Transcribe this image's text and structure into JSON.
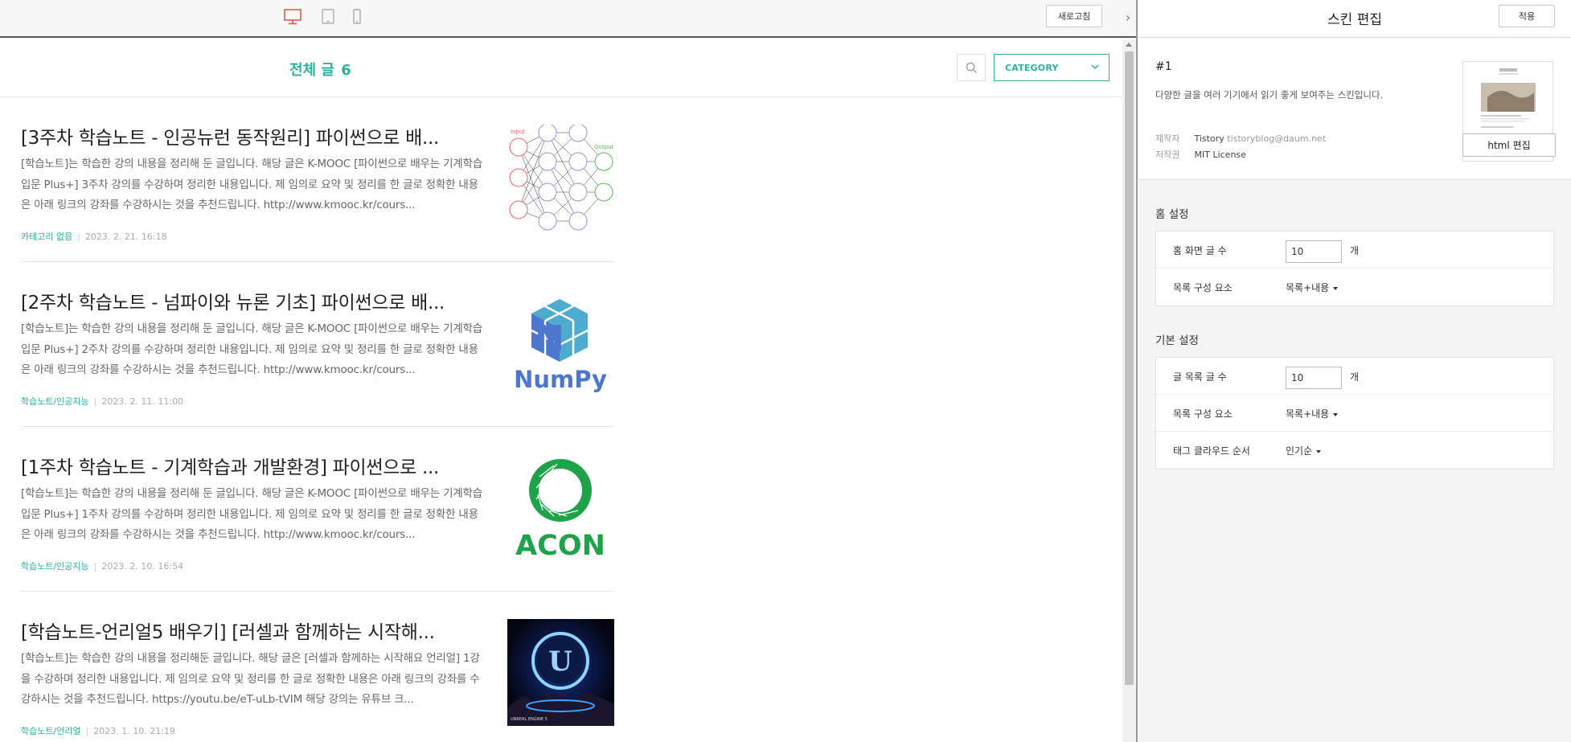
{
  "toolbar": {
    "devices": [
      {
        "name": "desktop",
        "icon": "desktop-monitor-icon",
        "active": true
      },
      {
        "name": "tablet",
        "icon": "tablet-icon",
        "active": false
      },
      {
        "name": "mobile",
        "icon": "mobile-phone-icon",
        "active": false
      }
    ],
    "refresh_label": "새로고침",
    "collapse_icon": "chevron-right-icon"
  },
  "blog": {
    "total_label": "전체 글",
    "total_count": "6",
    "search_icon": "search-icon",
    "category_label": "CATEGORY",
    "accent_color": "#2fae9b",
    "posts": [
      {
        "title": "[3주차 학습노트 - 인공뉴런 동작원리] 파이썬으로 배...",
        "excerpt": "[학습노트]는 학습한 강의 내용을 정리해 둔 글입니다. 해당 글은 K-MOOC [파이썬으로 배우는 기계학습 입문 Plus+] 3주차 강의를 수강하며 정리한 내용입니다. 제 임의로 요약 및 정리를 한 글로 정확한 내용은 아래 링크의 강좌를 수강하시는 것을 추천드립니다. http://www.kmooc.kr/cours...",
        "category": "카테고리 없음",
        "date": "2023. 2. 21. 16:18",
        "thumbnail": "neural-network-diagram",
        "thumb_labels": {
          "input": "Input",
          "output": "Output"
        }
      },
      {
        "title": "[2주차 학습노트 - 넘파이와 뉴론 기초] 파이썬으로 배...",
        "excerpt": "[학습노트]는 학습한 강의 내용을 정리해 둔 글입니다. 해당 글은 K-MOOC [파이썬으로 배우는 기계학습 입문 Plus+] 2주차 강의를 수강하며 정리한 내용입니다. 제 임의로 요약 및 정리를 한 글로 정확한 내용은 아래 링크의 강좌를 수강하시는 것을 추천드립니다. http://www.kmooc.kr/cours...",
        "category": "학습노트/인공지능",
        "date": "2023. 2. 11. 11:00",
        "thumbnail": "numpy-logo",
        "thumb_text": "NumPy"
      },
      {
        "title": "[1주차 학습노트 - 기계학습과 개발환경] 파이썬으로 ...",
        "excerpt": "[학습노트]는 학습한 강의 내용을 정리해 둔 글입니다. 해당 글은 K-MOOC [파이썬으로 배우는 기계학습 입문 Plus+] 1주차 강의를 수강하며 정리한 내용입니다. 제 임의로 요약 및 정리를 한 글로 정확한 내용은 아래 링크의 강좌를 수강하시는 것을 추천드립니다. http://www.kmooc.kr/cours...",
        "category": "학습노트/인공지능",
        "date": "2023. 2. 10. 16:54",
        "thumbnail": "acon-logo",
        "thumb_text": "ACON"
      },
      {
        "title": "[학습노트-언리얼5 배우기] [러셀과 함께하는 시작해...",
        "excerpt": "[학습노트]는 학습한 강의 내용을 정리해둔 글입니다. 해당 글은 [러셀과 함께하는 시작해요 언리얼] 1강 을 수강하며 정리한 내용입니다. 제 임의로 요약 및 정리를 한 글로 정확한 내용은 아래 링크의 강좌를 수강하시는 것을 추천드립니다. https://youtu.be/eT-uLb-tVIM 해당 강의는 유튜브 크...",
        "category": "학습노트/언리얼",
        "date": "2023. 1. 10. 21:19",
        "thumbnail": "unreal-engine-logo",
        "thumb_text": "UNREAL ENGINE 5"
      }
    ]
  },
  "panel": {
    "title": "스킨 편집",
    "apply_label": "적용",
    "skin": {
      "number": "#1",
      "description": "다양한 글을 여러 기기에서 읽기 좋게 보여주는 스킨입니다.",
      "author_key": "제작자",
      "author_name": "Tistory",
      "author_email": "tistoryblog@daum.net",
      "license_key": "저작권",
      "license_value": "MIT License",
      "html_edit_label": "html 편집"
    },
    "home_settings": {
      "title": "홈 설정",
      "rows": [
        {
          "label": "홈 화면 글 수",
          "value": "10",
          "unit": "개"
        },
        {
          "label": "목록 구성 요소",
          "dropdown": "목록+내용"
        }
      ]
    },
    "basic_settings": {
      "title": "기본 설정",
      "rows": [
        {
          "label": "글 목록 글 수",
          "value": "10",
          "unit": "개"
        },
        {
          "label": "목록 구성 요소",
          "dropdown": "목록+내용"
        },
        {
          "label": "태그 클라우드 순서",
          "dropdown": "인기순"
        }
      ]
    }
  }
}
